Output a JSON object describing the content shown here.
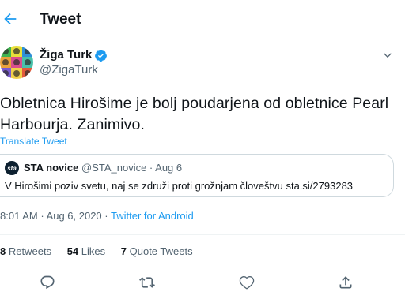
{
  "header": {
    "title": "Tweet",
    "back_icon": "arrow-left-icon"
  },
  "tweet": {
    "author": {
      "name": "Žiga Turk",
      "handle": "@ZigaTurk",
      "verified": true
    },
    "text": "Obletnica Hirošime je bolj poudarjena od obletnice Pearl Harbourja. Zanimivo.",
    "translate_label": "Translate Tweet",
    "quote": {
      "avatar_text": "sta",
      "name": "STA novice",
      "handle": "@STA_novice",
      "separator": " · ",
      "date": "Aug 6",
      "text": "V Hirošimi poziv svetu, naj se združi proti grožnjam človeštvu sta.si/2793283"
    },
    "time": "8:01 AM",
    "date": "Aug 6, 2020",
    "separator": " · ",
    "source": "Twitter for Android",
    "stats": {
      "retweets_count": "8",
      "retweets_label": "Retweets",
      "likes_count": "54",
      "likes_label": "Likes",
      "quotes_count": "7",
      "quotes_label": "Quote Tweets"
    }
  },
  "colors": {
    "accent": "#1d9bf0",
    "text": "#0f1419",
    "secondary": "#536471",
    "border": "#cfd9de"
  },
  "icons": [
    "arrow-left-icon",
    "verified-badge-icon",
    "chevron-down-icon",
    "reply-icon",
    "retweet-icon",
    "like-icon",
    "share-icon"
  ]
}
